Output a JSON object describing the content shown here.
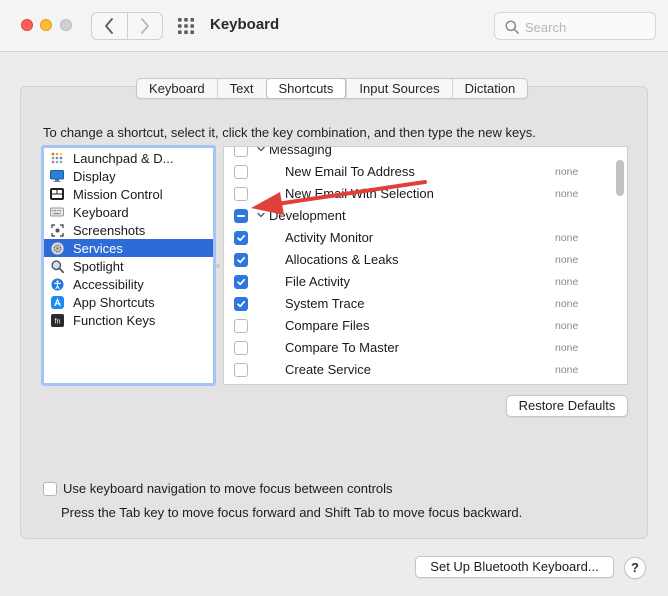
{
  "window": {
    "title": "Keyboard"
  },
  "search": {
    "placeholder": "Search"
  },
  "tabs": [
    {
      "label": "Keyboard",
      "selected": false
    },
    {
      "label": "Text",
      "selected": false
    },
    {
      "label": "Shortcuts",
      "selected": true
    },
    {
      "label": "Input Sources",
      "selected": false
    },
    {
      "label": "Dictation",
      "selected": false
    }
  ],
  "instruction": "To change a shortcut, select it, click the key combination, and then type the new keys.",
  "categories": [
    {
      "label": "Launchpad & D...",
      "icon": "launchpad-icon",
      "selected": false
    },
    {
      "label": "Display",
      "icon": "display-icon",
      "selected": false
    },
    {
      "label": "Mission Control",
      "icon": "mission-control-icon",
      "selected": false
    },
    {
      "label": "Keyboard",
      "icon": "keyboard-icon",
      "selected": false
    },
    {
      "label": "Screenshots",
      "icon": "screenshot-icon",
      "selected": false
    },
    {
      "label": "Services",
      "icon": "gear-icon",
      "selected": true
    },
    {
      "label": "Spotlight",
      "icon": "magnifier-icon",
      "selected": false
    },
    {
      "label": "Accessibility",
      "icon": "accessibility-icon",
      "selected": false
    },
    {
      "label": "App Shortcuts",
      "icon": "app-store-icon",
      "selected": false
    },
    {
      "label": "Function Keys",
      "icon": "fn-key-icon",
      "selected": false
    }
  ],
  "shortcuts": [
    {
      "type": "group",
      "label": "Messaging",
      "state": "unchecked",
      "key": ""
    },
    {
      "type": "item",
      "label": "New Email To Address",
      "state": "unchecked",
      "key": "none"
    },
    {
      "type": "item",
      "label": "New Email With Selection",
      "state": "unchecked",
      "key": "none"
    },
    {
      "type": "group",
      "label": "Development",
      "state": "mixed",
      "key": ""
    },
    {
      "type": "item",
      "label": "Activity Monitor",
      "state": "checked",
      "key": "none"
    },
    {
      "type": "item",
      "label": "Allocations & Leaks",
      "state": "checked",
      "key": "none"
    },
    {
      "type": "item",
      "label": "File Activity",
      "state": "checked",
      "key": "none"
    },
    {
      "type": "item",
      "label": "System Trace",
      "state": "checked",
      "key": "none"
    },
    {
      "type": "item",
      "label": "Compare Files",
      "state": "unchecked",
      "key": "none"
    },
    {
      "type": "item",
      "label": "Compare To Master",
      "state": "unchecked",
      "key": "none"
    },
    {
      "type": "item",
      "label": "Create Service",
      "state": "unchecked",
      "key": "none"
    }
  ],
  "buttons": {
    "restore_defaults": "Restore Defaults",
    "bluetooth": "Set Up Bluetooth Keyboard...",
    "help": "?"
  },
  "keyboard_navigation": {
    "label": "Use keyboard navigation to move focus between controls",
    "checked": false,
    "hint": "Press the Tab key to move focus forward and Shift Tab to move focus backward."
  },
  "annotation_arrow": {
    "color": "#e0403a"
  },
  "colors": {
    "selection": "#2d6cd6",
    "checkbox_accent": "#2f76dd",
    "focus_ring": "#a4c4f3"
  }
}
